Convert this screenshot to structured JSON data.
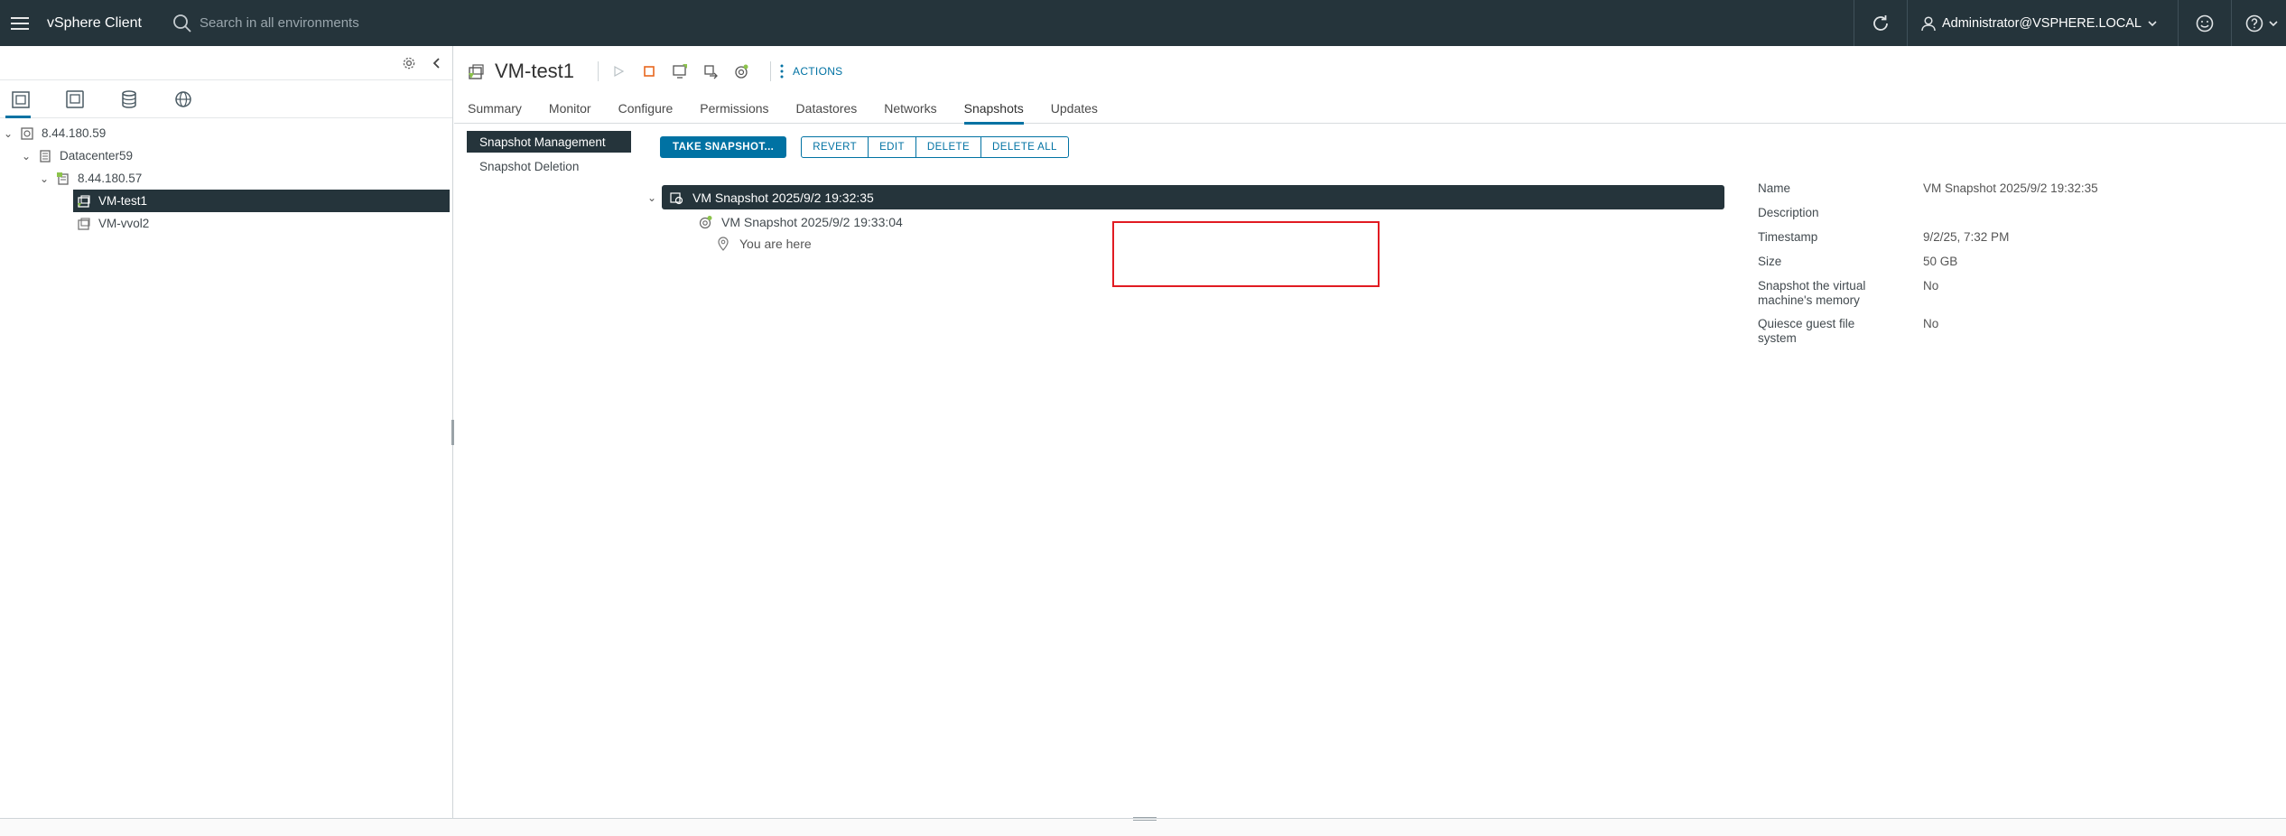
{
  "header": {
    "app_title": "vSphere Client",
    "search_placeholder": "Search in all environments",
    "user": "Administrator@VSPHERE.LOCAL"
  },
  "navigator": {
    "tree": [
      {
        "label": "8.44.180.59",
        "level": 0,
        "icon": "vcenter-icon",
        "expanded": true
      },
      {
        "label": "Datacenter59",
        "level": 1,
        "icon": "datacenter-icon",
        "expanded": true
      },
      {
        "label": "8.44.180.57",
        "level": 2,
        "icon": "host-icon",
        "expanded": true
      },
      {
        "label": "VM-test1",
        "level": 3,
        "icon": "vm-icon",
        "selected": true
      },
      {
        "label": "VM-vvol2",
        "level": 3,
        "icon": "vm-icon"
      }
    ]
  },
  "object": {
    "title": "VM-test1",
    "actions_label": "ACTIONS"
  },
  "tabs": [
    "Summary",
    "Monitor",
    "Configure",
    "Permissions",
    "Datastores",
    "Networks",
    "Snapshots",
    "Updates"
  ],
  "active_tab": "Snapshots",
  "subnav": [
    "Snapshot Management",
    "Snapshot Deletion"
  ],
  "toolbar": {
    "take": "TAKE SNAPSHOT...",
    "revert": "REVERT",
    "edit": "EDIT",
    "delete": "DELETE",
    "delete_all": "DELETE ALL"
  },
  "snapshots": {
    "root": "VM Snapshot 2025/9/2 19:32:35",
    "child": "VM Snapshot 2025/9/2 19:33:04",
    "here": "You are here"
  },
  "details": [
    {
      "key": "Name",
      "value": "VM Snapshot 2025/9/2 19:32:35"
    },
    {
      "key": "Description",
      "value": ""
    },
    {
      "key": "Timestamp",
      "value": "9/2/25, 7:32 PM"
    },
    {
      "key": "Size",
      "value": "50 GB"
    },
    {
      "key": "Snapshot the virtual machine's memory",
      "value": "No"
    },
    {
      "key": "Quiesce guest file system",
      "value": "No"
    }
  ],
  "colors": {
    "header_bg": "#25343b",
    "accent": "#0072a3",
    "highlight": "#e11b22"
  }
}
